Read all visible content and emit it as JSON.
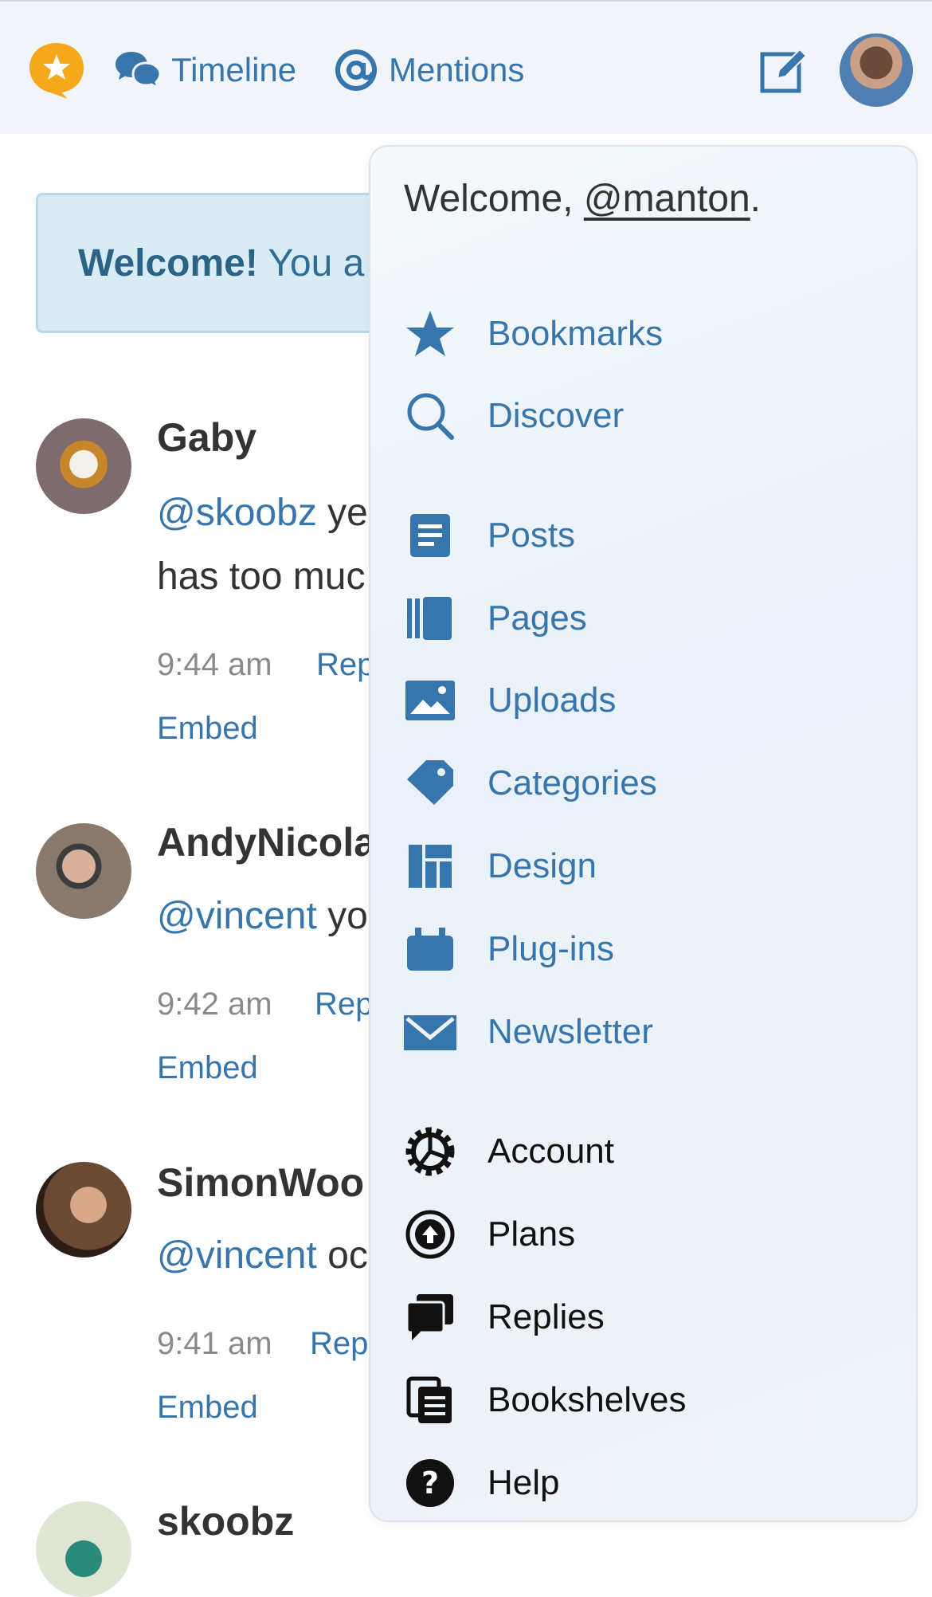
{
  "nav": {
    "timeline": "Timeline",
    "mentions": "Mentions"
  },
  "banner": {
    "bold": "Welcome!",
    "text": "You a"
  },
  "posts": [
    {
      "name": "Gaby",
      "mention": "@skoobz",
      "rest": " ye",
      "line2": "has too muc",
      "time": "9:44 am",
      "reply": "Rep",
      "embed": "Embed"
    },
    {
      "name": "AndyNicola",
      "mention": "@vincent",
      "rest": " yo",
      "time": "9:42 am",
      "reply": "Rep",
      "embed": "Embed"
    },
    {
      "name": "SimonWoo",
      "mention": "@vincent",
      "rest": " oc",
      "time": "9:41 am",
      "reply": "Rep",
      "embed": "Embed"
    },
    {
      "name": "skoobz"
    }
  ],
  "menu": {
    "welcome_prefix": "Welcome, ",
    "username": "@manton",
    "welcome_suffix": ".",
    "items": [
      {
        "label": "Bookmarks",
        "icon": "star-icon"
      },
      {
        "label": "Discover",
        "icon": "search-icon"
      },
      {
        "label": "Posts",
        "icon": "posts-icon"
      },
      {
        "label": "Pages",
        "icon": "pages-icon"
      },
      {
        "label": "Uploads",
        "icon": "image-icon"
      },
      {
        "label": "Categories",
        "icon": "tag-icon"
      },
      {
        "label": "Design",
        "icon": "layout-icon"
      },
      {
        "label": "Plug-ins",
        "icon": "plugin-icon"
      },
      {
        "label": "Newsletter",
        "icon": "envelope-icon"
      },
      {
        "label": "Account",
        "icon": "gear-icon"
      },
      {
        "label": "Plans",
        "icon": "upgrade-circle-icon"
      },
      {
        "label": "Replies",
        "icon": "chat-bubbles-icon"
      },
      {
        "label": "Bookshelves",
        "icon": "bookshelves-icon"
      },
      {
        "label": "Help",
        "icon": "help-icon"
      }
    ]
  },
  "colors": {
    "link": "#3676ad",
    "menu_bg": "#eef3f8",
    "banner_bg": "#d9ecf6",
    "logo": "#f6a81c"
  }
}
